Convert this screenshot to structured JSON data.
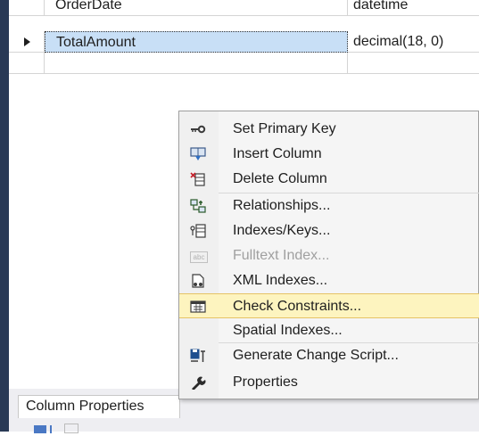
{
  "grid": {
    "rows": [
      {
        "name": "OrderDate",
        "type": "datetime",
        "current": false
      },
      {
        "name": "TotalAmount",
        "type": "decimal(18, 0)",
        "current": true
      },
      {
        "name": "",
        "type": "",
        "current": false
      }
    ]
  },
  "context_menu": {
    "items": [
      {
        "label": "Set Primary Key",
        "icon": "key-icon",
        "glyph": "⊸",
        "enabled": true
      },
      {
        "label": "Insert Column",
        "icon": "insert-column-icon",
        "glyph": "⧉",
        "enabled": true
      },
      {
        "label": "Delete Column",
        "icon": "delete-column-icon",
        "glyph": "⊠",
        "enabled": true
      },
      {
        "label": "Relationships...",
        "icon": "relationships-icon",
        "glyph": "⊞",
        "enabled": true
      },
      {
        "label": "Indexes/Keys...",
        "icon": "indexes-icon",
        "glyph": "⊟",
        "enabled": true
      },
      {
        "label": "Fulltext Index...",
        "icon": "fulltext-icon",
        "glyph": "abc",
        "enabled": false
      },
      {
        "label": "XML Indexes...",
        "icon": "xml-index-icon",
        "glyph": "⎘",
        "enabled": true
      },
      {
        "label": "Check Constraints...",
        "icon": "check-constraints-icon",
        "glyph": "▦",
        "enabled": true
      },
      {
        "label": "Spatial Indexes...",
        "icon": "",
        "glyph": "",
        "enabled": true
      },
      {
        "label": "Generate Change Script...",
        "icon": "change-script-icon",
        "glyph": "⛁",
        "enabled": true
      },
      {
        "label": "Properties",
        "icon": "wrench-icon",
        "glyph": "✎",
        "enabled": true
      }
    ]
  },
  "properties_panel": {
    "tab_label": "Column Properties"
  }
}
